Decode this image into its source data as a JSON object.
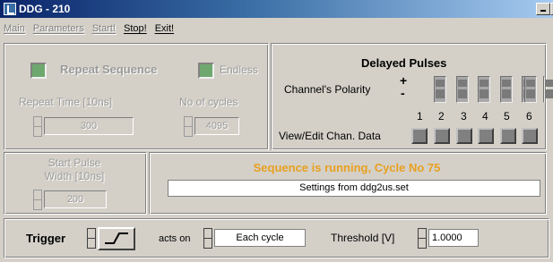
{
  "window": {
    "title": "DDG - 210"
  },
  "menu": [
    {
      "label": "Main",
      "state": "disabled"
    },
    {
      "label": "Parameters",
      "state": "disabled"
    },
    {
      "label": "Start!",
      "state": "disabled"
    },
    {
      "label": "Stop!",
      "state": "active"
    },
    {
      "label": "Exit!",
      "state": "active"
    }
  ],
  "repeat": {
    "repeat_sequence_label": "Repeat Sequence",
    "endless_label": "Endless",
    "repeat_time_label": "Repeat Time [10ns]",
    "repeat_time_value": "300",
    "cycles_label": "No of cycles",
    "cycles_value": "4095"
  },
  "delayed": {
    "title": "Delayed Pulses",
    "polarity_label": "Channel's Polarity",
    "plus": "+",
    "minus": "-",
    "channels": [
      "1",
      "2",
      "3",
      "4",
      "5",
      "6"
    ],
    "view_edit_label": "View/Edit Chan. Data"
  },
  "start_pulse": {
    "label_line1": "Start Pulse",
    "label_line2": "Width [10ns]",
    "value": "200"
  },
  "status": {
    "running_text": "Sequence is running, Cycle No 75",
    "settings_text": "Settings from ddg2us.set",
    "running_color": "#e8a020"
  },
  "trigger": {
    "label": "Trigger",
    "acts_on_label": "acts on",
    "acts_on_value": "Each cycle",
    "threshold_label": "Threshold [V]",
    "threshold_value": "1.0000"
  },
  "colors": {
    "led_green": "#6fa86f",
    "window_bg": "#d4d0c8"
  }
}
